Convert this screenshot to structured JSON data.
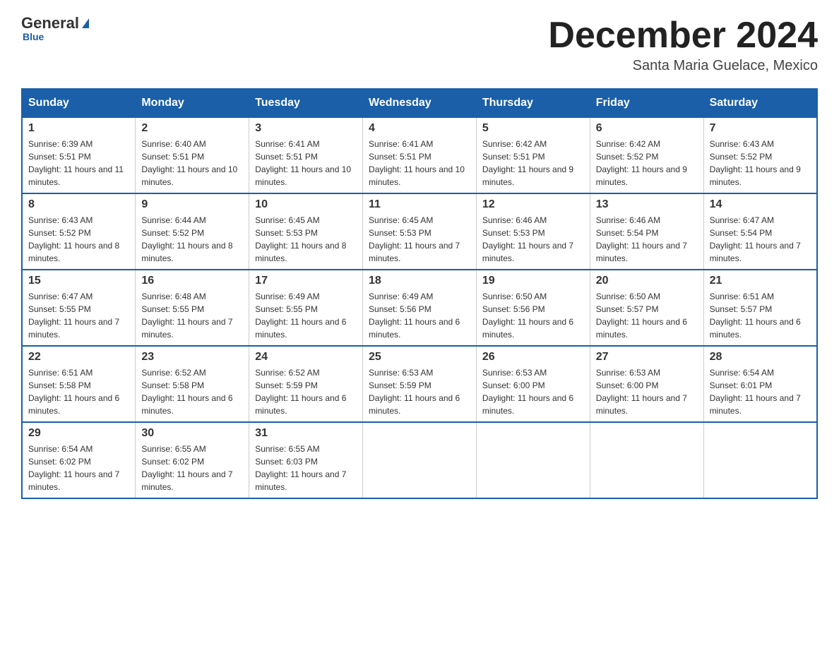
{
  "header": {
    "logo": {
      "general": "General",
      "blue": "Blue"
    },
    "title": "December 2024",
    "location": "Santa Maria Guelace, Mexico"
  },
  "weekdays": [
    "Sunday",
    "Monday",
    "Tuesday",
    "Wednesday",
    "Thursday",
    "Friday",
    "Saturday"
  ],
  "weeks": [
    [
      {
        "day": "1",
        "sunrise": "6:39 AM",
        "sunset": "5:51 PM",
        "daylight": "11 hours and 11 minutes."
      },
      {
        "day": "2",
        "sunrise": "6:40 AM",
        "sunset": "5:51 PM",
        "daylight": "11 hours and 10 minutes."
      },
      {
        "day": "3",
        "sunrise": "6:41 AM",
        "sunset": "5:51 PM",
        "daylight": "11 hours and 10 minutes."
      },
      {
        "day": "4",
        "sunrise": "6:41 AM",
        "sunset": "5:51 PM",
        "daylight": "11 hours and 10 minutes."
      },
      {
        "day": "5",
        "sunrise": "6:42 AM",
        "sunset": "5:51 PM",
        "daylight": "11 hours and 9 minutes."
      },
      {
        "day": "6",
        "sunrise": "6:42 AM",
        "sunset": "5:52 PM",
        "daylight": "11 hours and 9 minutes."
      },
      {
        "day": "7",
        "sunrise": "6:43 AM",
        "sunset": "5:52 PM",
        "daylight": "11 hours and 9 minutes."
      }
    ],
    [
      {
        "day": "8",
        "sunrise": "6:43 AM",
        "sunset": "5:52 PM",
        "daylight": "11 hours and 8 minutes."
      },
      {
        "day": "9",
        "sunrise": "6:44 AM",
        "sunset": "5:52 PM",
        "daylight": "11 hours and 8 minutes."
      },
      {
        "day": "10",
        "sunrise": "6:45 AM",
        "sunset": "5:53 PM",
        "daylight": "11 hours and 8 minutes."
      },
      {
        "day": "11",
        "sunrise": "6:45 AM",
        "sunset": "5:53 PM",
        "daylight": "11 hours and 7 minutes."
      },
      {
        "day": "12",
        "sunrise": "6:46 AM",
        "sunset": "5:53 PM",
        "daylight": "11 hours and 7 minutes."
      },
      {
        "day": "13",
        "sunrise": "6:46 AM",
        "sunset": "5:54 PM",
        "daylight": "11 hours and 7 minutes."
      },
      {
        "day": "14",
        "sunrise": "6:47 AM",
        "sunset": "5:54 PM",
        "daylight": "11 hours and 7 minutes."
      }
    ],
    [
      {
        "day": "15",
        "sunrise": "6:47 AM",
        "sunset": "5:55 PM",
        "daylight": "11 hours and 7 minutes."
      },
      {
        "day": "16",
        "sunrise": "6:48 AM",
        "sunset": "5:55 PM",
        "daylight": "11 hours and 7 minutes."
      },
      {
        "day": "17",
        "sunrise": "6:49 AM",
        "sunset": "5:55 PM",
        "daylight": "11 hours and 6 minutes."
      },
      {
        "day": "18",
        "sunrise": "6:49 AM",
        "sunset": "5:56 PM",
        "daylight": "11 hours and 6 minutes."
      },
      {
        "day": "19",
        "sunrise": "6:50 AM",
        "sunset": "5:56 PM",
        "daylight": "11 hours and 6 minutes."
      },
      {
        "day": "20",
        "sunrise": "6:50 AM",
        "sunset": "5:57 PM",
        "daylight": "11 hours and 6 minutes."
      },
      {
        "day": "21",
        "sunrise": "6:51 AM",
        "sunset": "5:57 PM",
        "daylight": "11 hours and 6 minutes."
      }
    ],
    [
      {
        "day": "22",
        "sunrise": "6:51 AM",
        "sunset": "5:58 PM",
        "daylight": "11 hours and 6 minutes."
      },
      {
        "day": "23",
        "sunrise": "6:52 AM",
        "sunset": "5:58 PM",
        "daylight": "11 hours and 6 minutes."
      },
      {
        "day": "24",
        "sunrise": "6:52 AM",
        "sunset": "5:59 PM",
        "daylight": "11 hours and 6 minutes."
      },
      {
        "day": "25",
        "sunrise": "6:53 AM",
        "sunset": "5:59 PM",
        "daylight": "11 hours and 6 minutes."
      },
      {
        "day": "26",
        "sunrise": "6:53 AM",
        "sunset": "6:00 PM",
        "daylight": "11 hours and 6 minutes."
      },
      {
        "day": "27",
        "sunrise": "6:53 AM",
        "sunset": "6:00 PM",
        "daylight": "11 hours and 7 minutes."
      },
      {
        "day": "28",
        "sunrise": "6:54 AM",
        "sunset": "6:01 PM",
        "daylight": "11 hours and 7 minutes."
      }
    ],
    [
      {
        "day": "29",
        "sunrise": "6:54 AM",
        "sunset": "6:02 PM",
        "daylight": "11 hours and 7 minutes."
      },
      {
        "day": "30",
        "sunrise": "6:55 AM",
        "sunset": "6:02 PM",
        "daylight": "11 hours and 7 minutes."
      },
      {
        "day": "31",
        "sunrise": "6:55 AM",
        "sunset": "6:03 PM",
        "daylight": "11 hours and 7 minutes."
      },
      null,
      null,
      null,
      null
    ]
  ],
  "labels": {
    "sunrise": "Sunrise:",
    "sunset": "Sunset:",
    "daylight": "Daylight:"
  }
}
